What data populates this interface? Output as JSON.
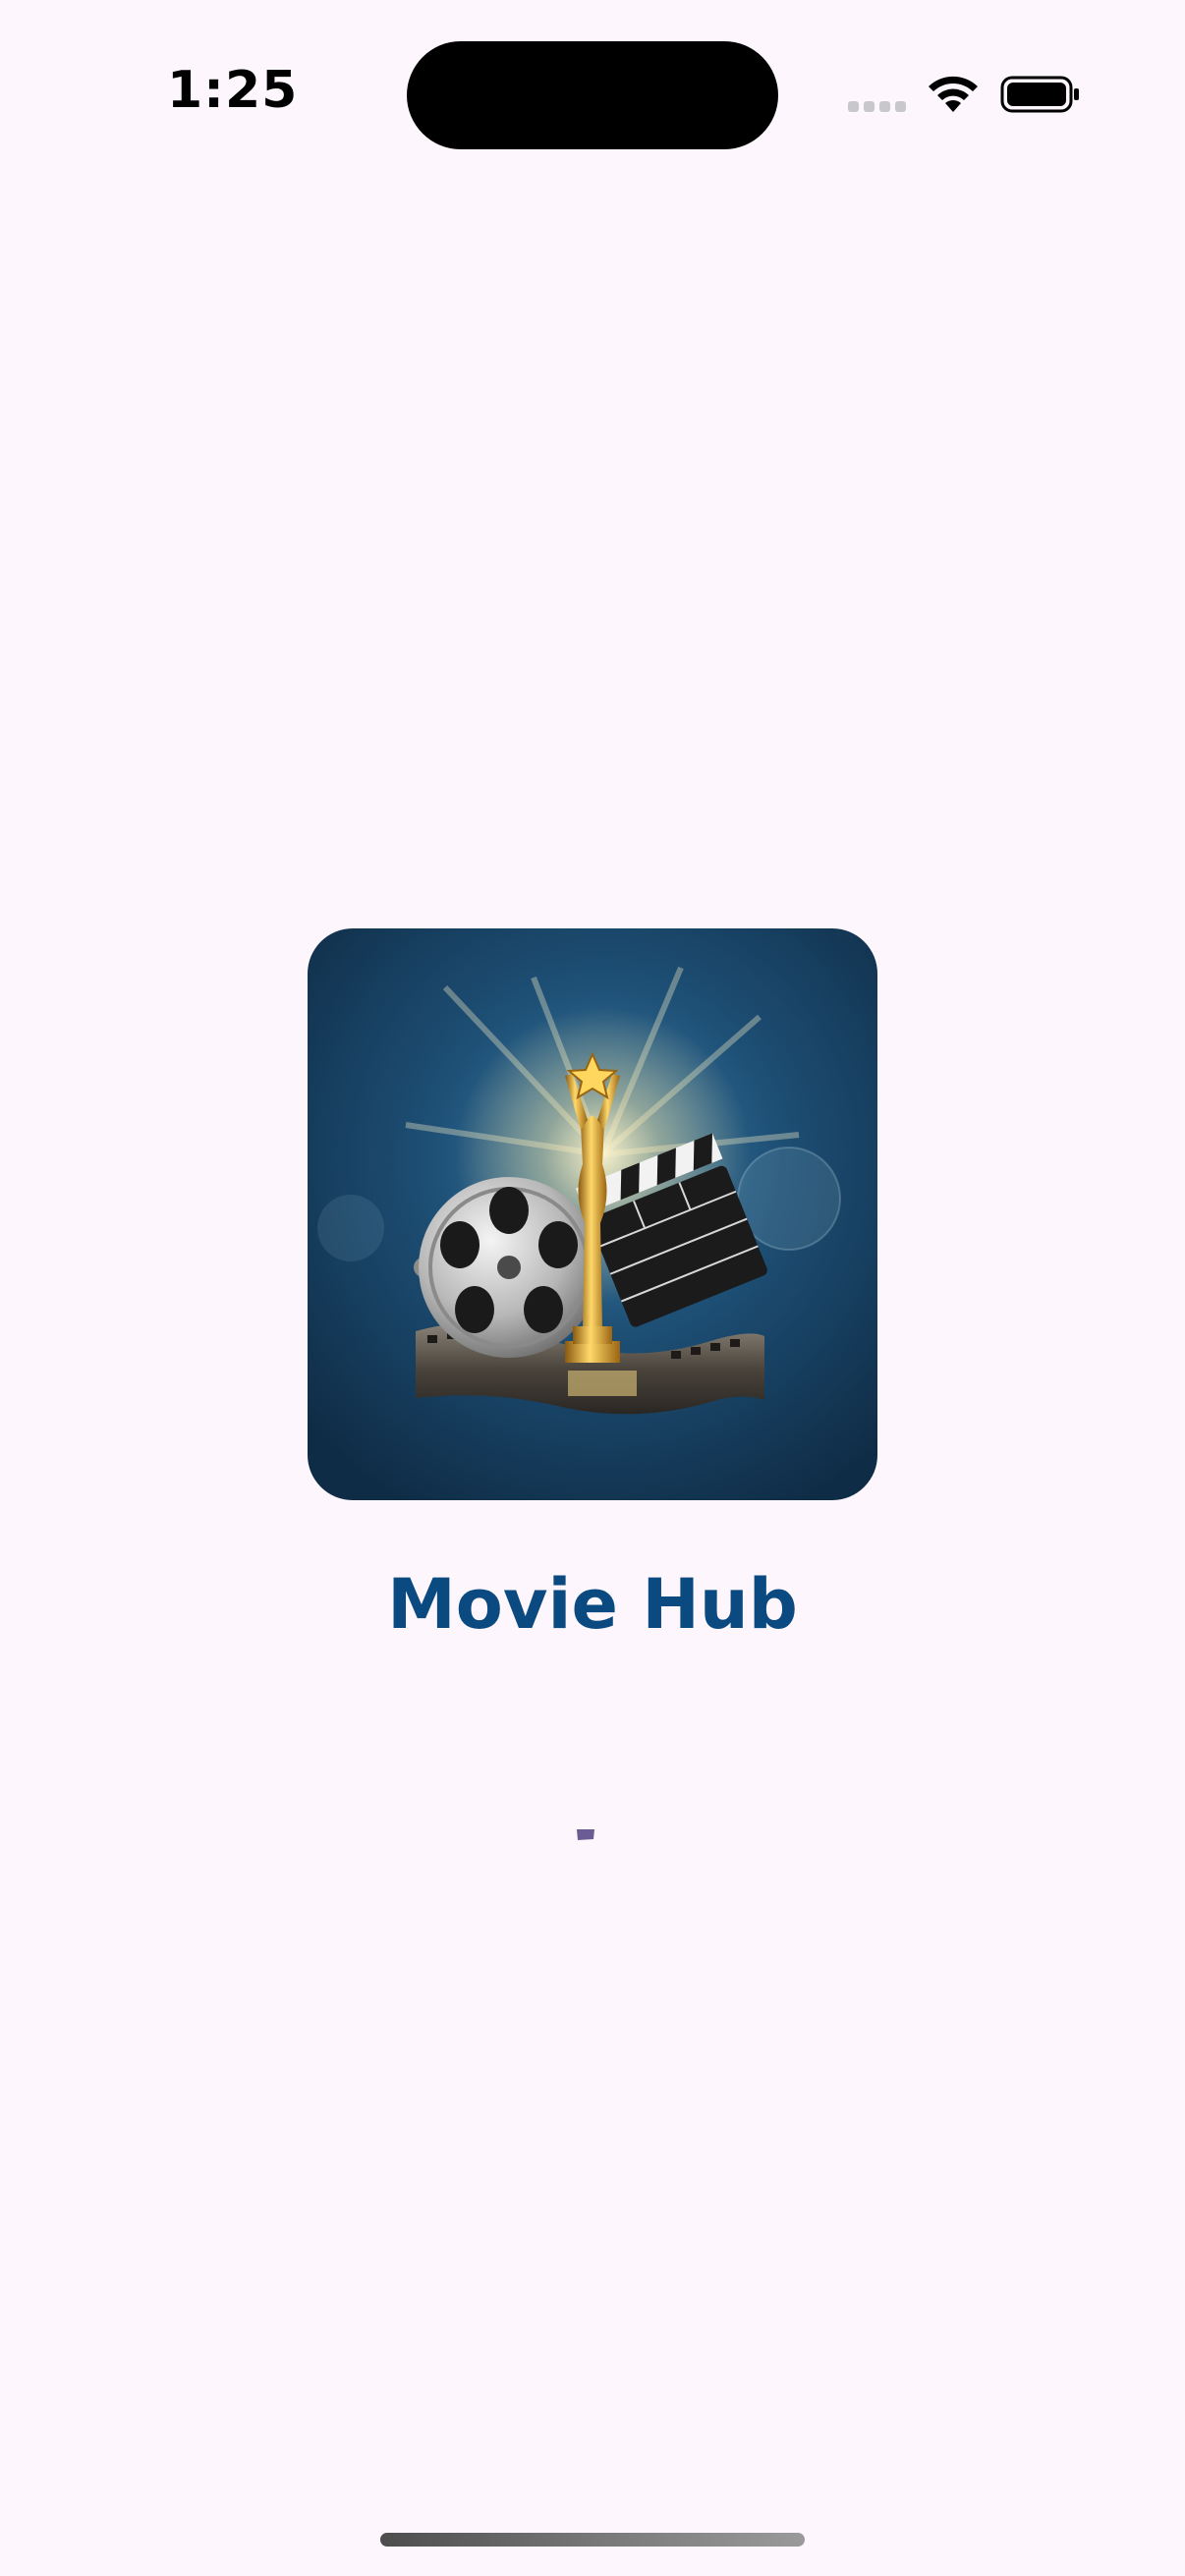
{
  "status_bar": {
    "time": "1:25",
    "icons": [
      "signal-icon",
      "wifi-icon",
      "battery-icon"
    ]
  },
  "splash": {
    "logo": "movie-hub-logo",
    "title": "Movie Hub",
    "loading": true
  },
  "colors": {
    "background": "#fdf6fc",
    "title": "#0b4a80",
    "spinner": "#6a5c94"
  }
}
